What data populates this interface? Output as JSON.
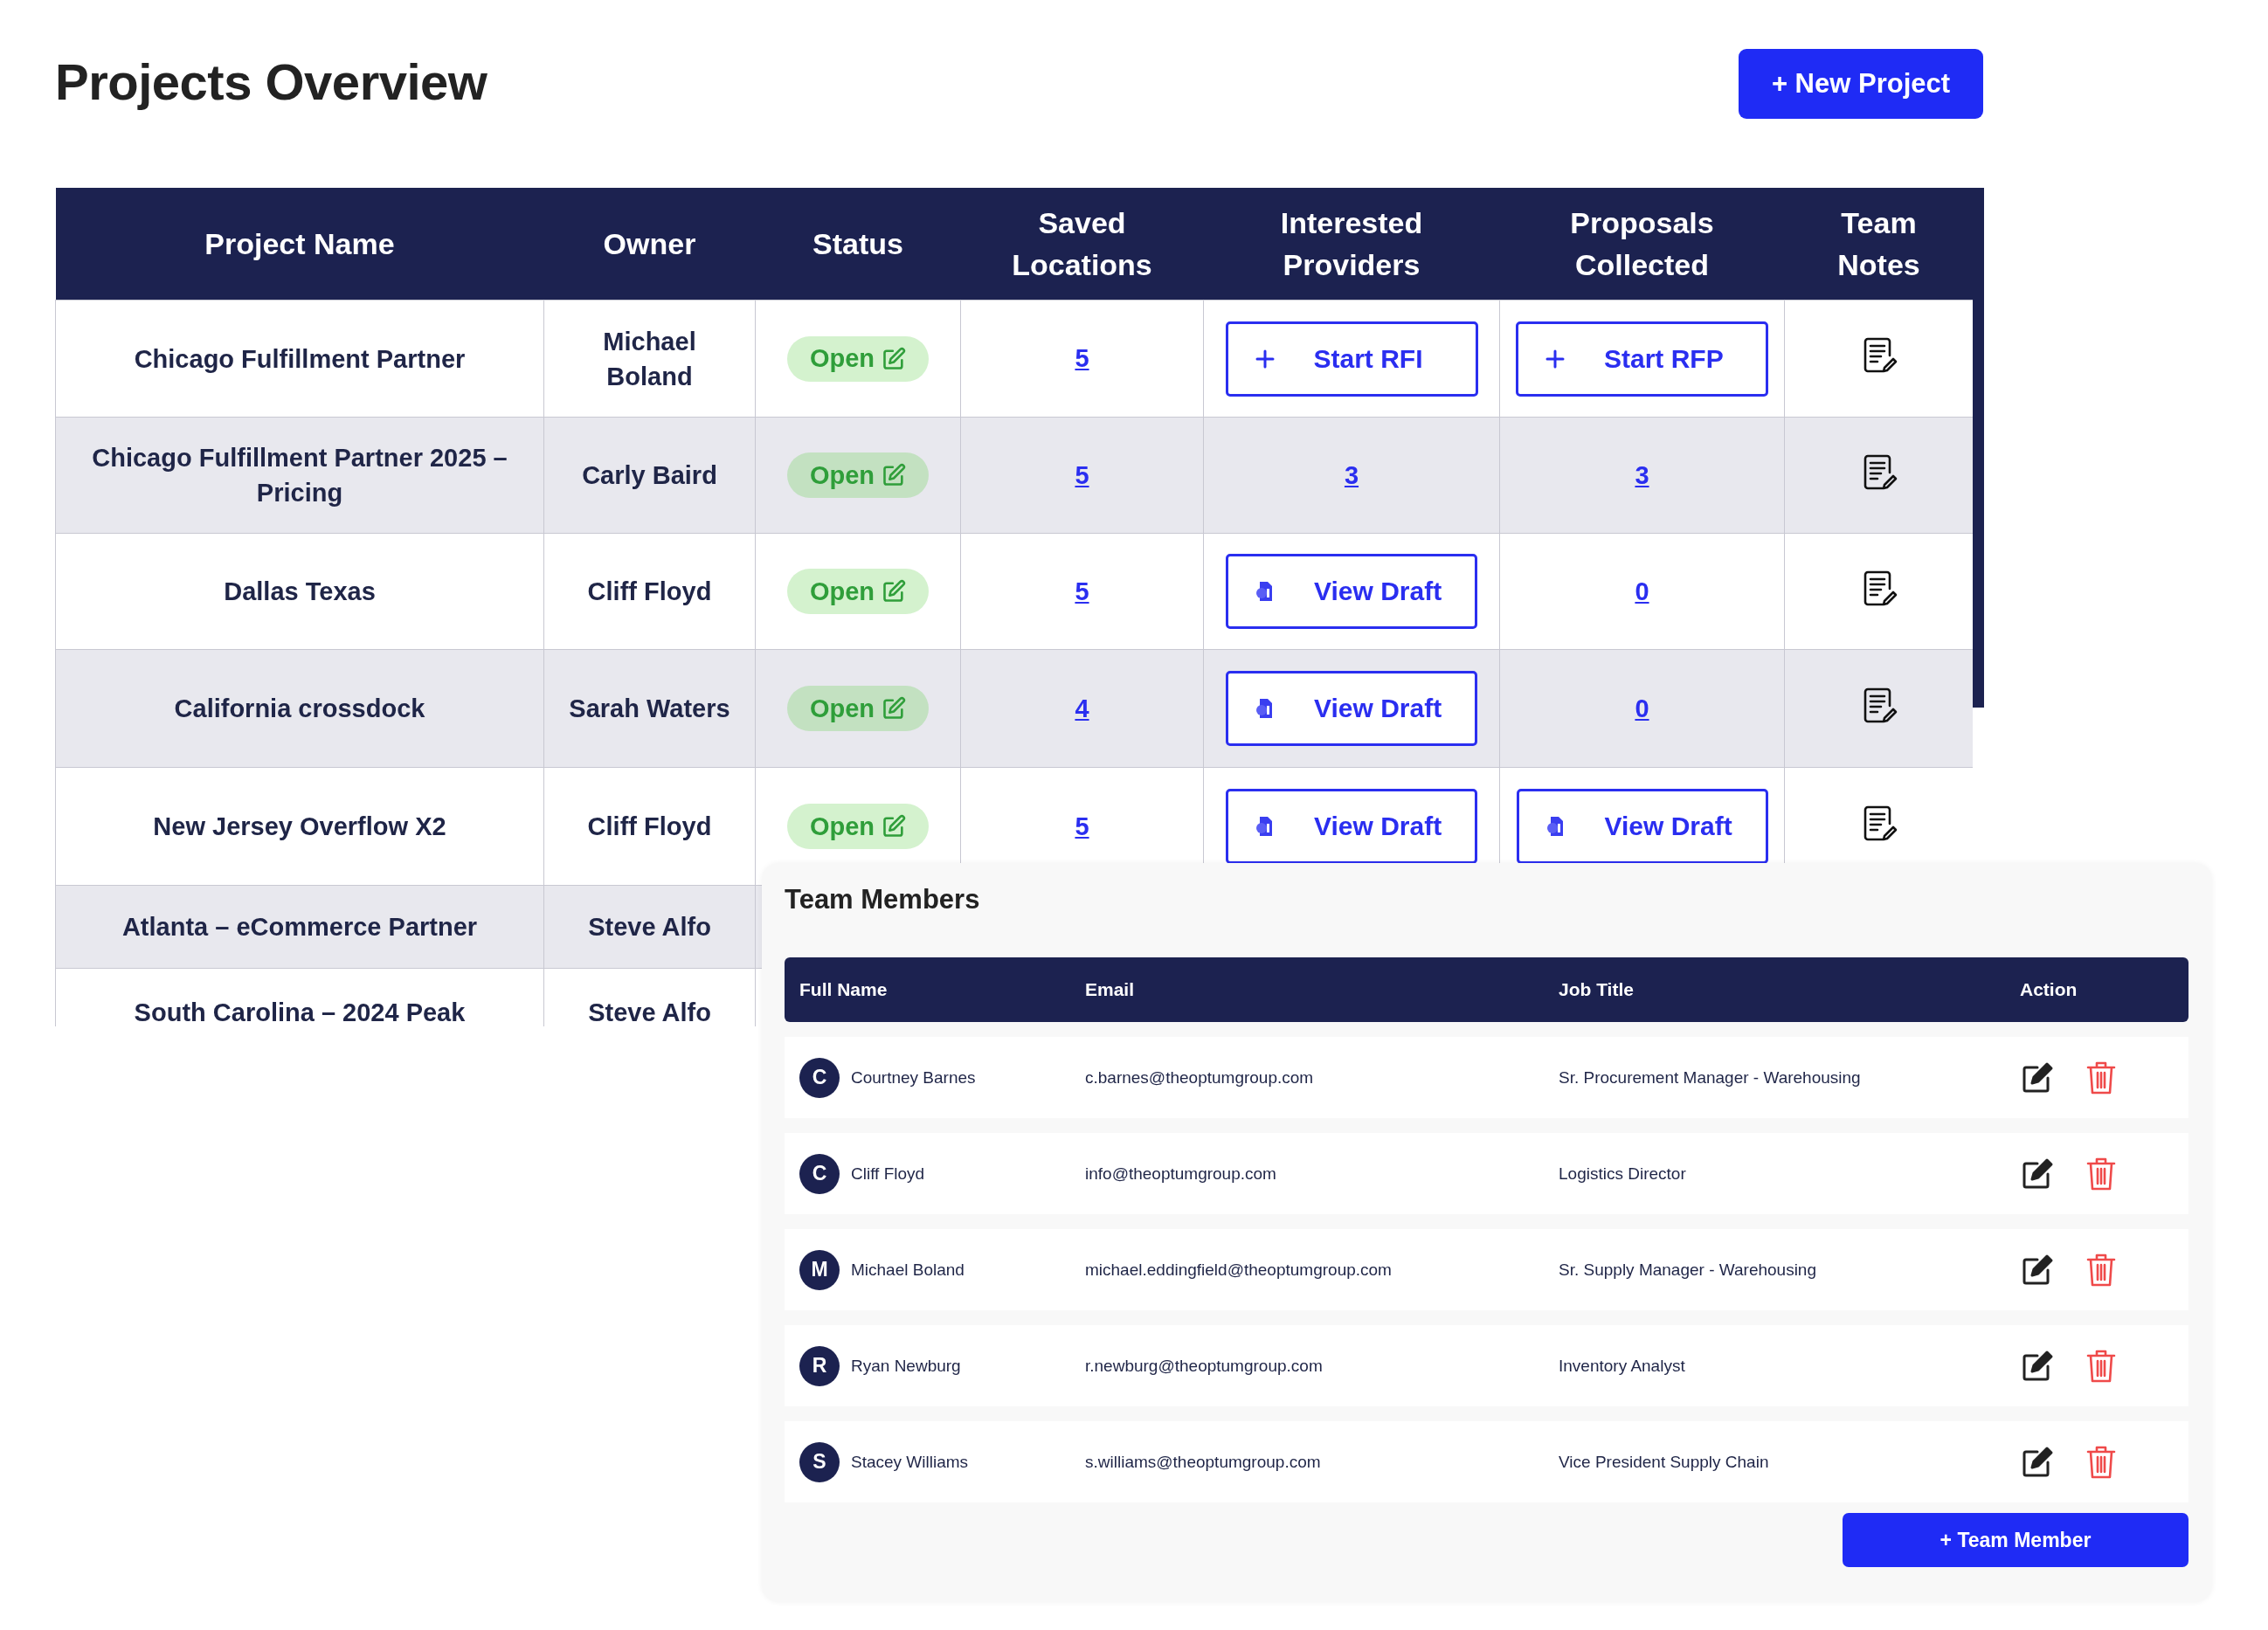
{
  "page": {
    "title": "Projects Overview",
    "new_button": "+ New Project"
  },
  "projects_table": {
    "columns": [
      "Project Name",
      "Owner",
      "Status",
      "Saved Locations",
      "Interested Providers",
      "Proposals Collected",
      "Team Notes"
    ],
    "rows": [
      {
        "name": "Chicago Fulfillment Partner",
        "owner": "Michael Boland",
        "status": "Open",
        "saved_locations": "5",
        "interested_providers": {
          "kind": "start",
          "label": "Start RFI"
        },
        "proposals": {
          "kind": "start",
          "label": "Start RFP"
        },
        "notes": true
      },
      {
        "name": "Chicago Fulfillment Partner 2025 – Pricing",
        "owner": "Carly Baird",
        "status": "Open",
        "saved_locations": "5",
        "interested_providers": {
          "kind": "link",
          "label": "3"
        },
        "proposals": {
          "kind": "link",
          "label": "3"
        },
        "notes": true
      },
      {
        "name": "Dallas Texas",
        "owner": "Cliff Floyd",
        "status": "Open",
        "saved_locations": "5",
        "interested_providers": {
          "kind": "draft",
          "label": "View Draft"
        },
        "proposals": {
          "kind": "link",
          "label": "0"
        },
        "notes": true
      },
      {
        "name": "California crossdock",
        "owner": "Sarah Waters",
        "status": "Open",
        "saved_locations": "4",
        "interested_providers": {
          "kind": "draft",
          "label": "View Draft"
        },
        "proposals": {
          "kind": "link",
          "label": "0"
        },
        "notes": true
      },
      {
        "name": "New Jersey Overflow X2",
        "owner": "Cliff Floyd",
        "status": "Open",
        "saved_locations": "5",
        "interested_providers": {
          "kind": "draft",
          "label": "View Draft"
        },
        "proposals": {
          "kind": "draft",
          "label": "View Draft"
        },
        "notes": true
      },
      {
        "name": "Atlanta – eCommerce Partner",
        "owner": "Steve Alfo"
      },
      {
        "name": "South Carolina – 2024 Peak",
        "owner": "Steve Alfo"
      }
    ]
  },
  "team_members": {
    "title": "Team Members",
    "columns": [
      "Full Name",
      "Email",
      "Job Title",
      "Action"
    ],
    "rows": [
      {
        "initial": "C",
        "name": "Courtney Barnes",
        "email": "c.barnes@theoptumgroup.com",
        "job_title": "Sr. Procurement Manager - Warehousing"
      },
      {
        "initial": "C",
        "name": "Cliff Floyd",
        "email": "info@theoptumgroup.com",
        "job_title": "Logistics Director"
      },
      {
        "initial": "M",
        "name": "Michael Boland",
        "email": "michael.eddingfield@theoptumgroup.com",
        "job_title": "Sr. Supply Manager - Warehousing"
      },
      {
        "initial": "R",
        "name": "Ryan Newburg",
        "email": "r.newburg@theoptumgroup.com",
        "job_title": "Inventory Analyst"
      },
      {
        "initial": "S",
        "name": "Stacey Williams",
        "email": "s.williams@theoptumgroup.com",
        "job_title": "Vice President Supply Chain"
      }
    ],
    "add_button": "+ Team Member"
  }
}
